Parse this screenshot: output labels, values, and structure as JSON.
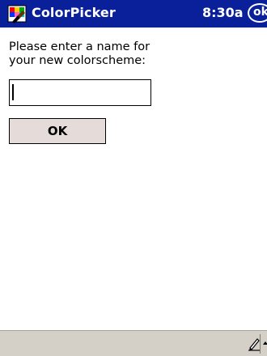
{
  "titlebar": {
    "app_name": "ColorPicker",
    "clock": "8:30a",
    "ok_label": "ok",
    "icon": "colorpicker-app-icon"
  },
  "dialog": {
    "prompt": "Please enter a name for your new colorscheme:",
    "input_value": "",
    "ok_button_label": "OK"
  },
  "command_bar": {
    "input_method_icon": "pen-icon",
    "sip_arrow_icon": "up-arrow-icon"
  },
  "colors": {
    "titlebar": "#0a1f9a",
    "button_face": "#e5dcd9",
    "command_bar": "#d4d0c8"
  }
}
